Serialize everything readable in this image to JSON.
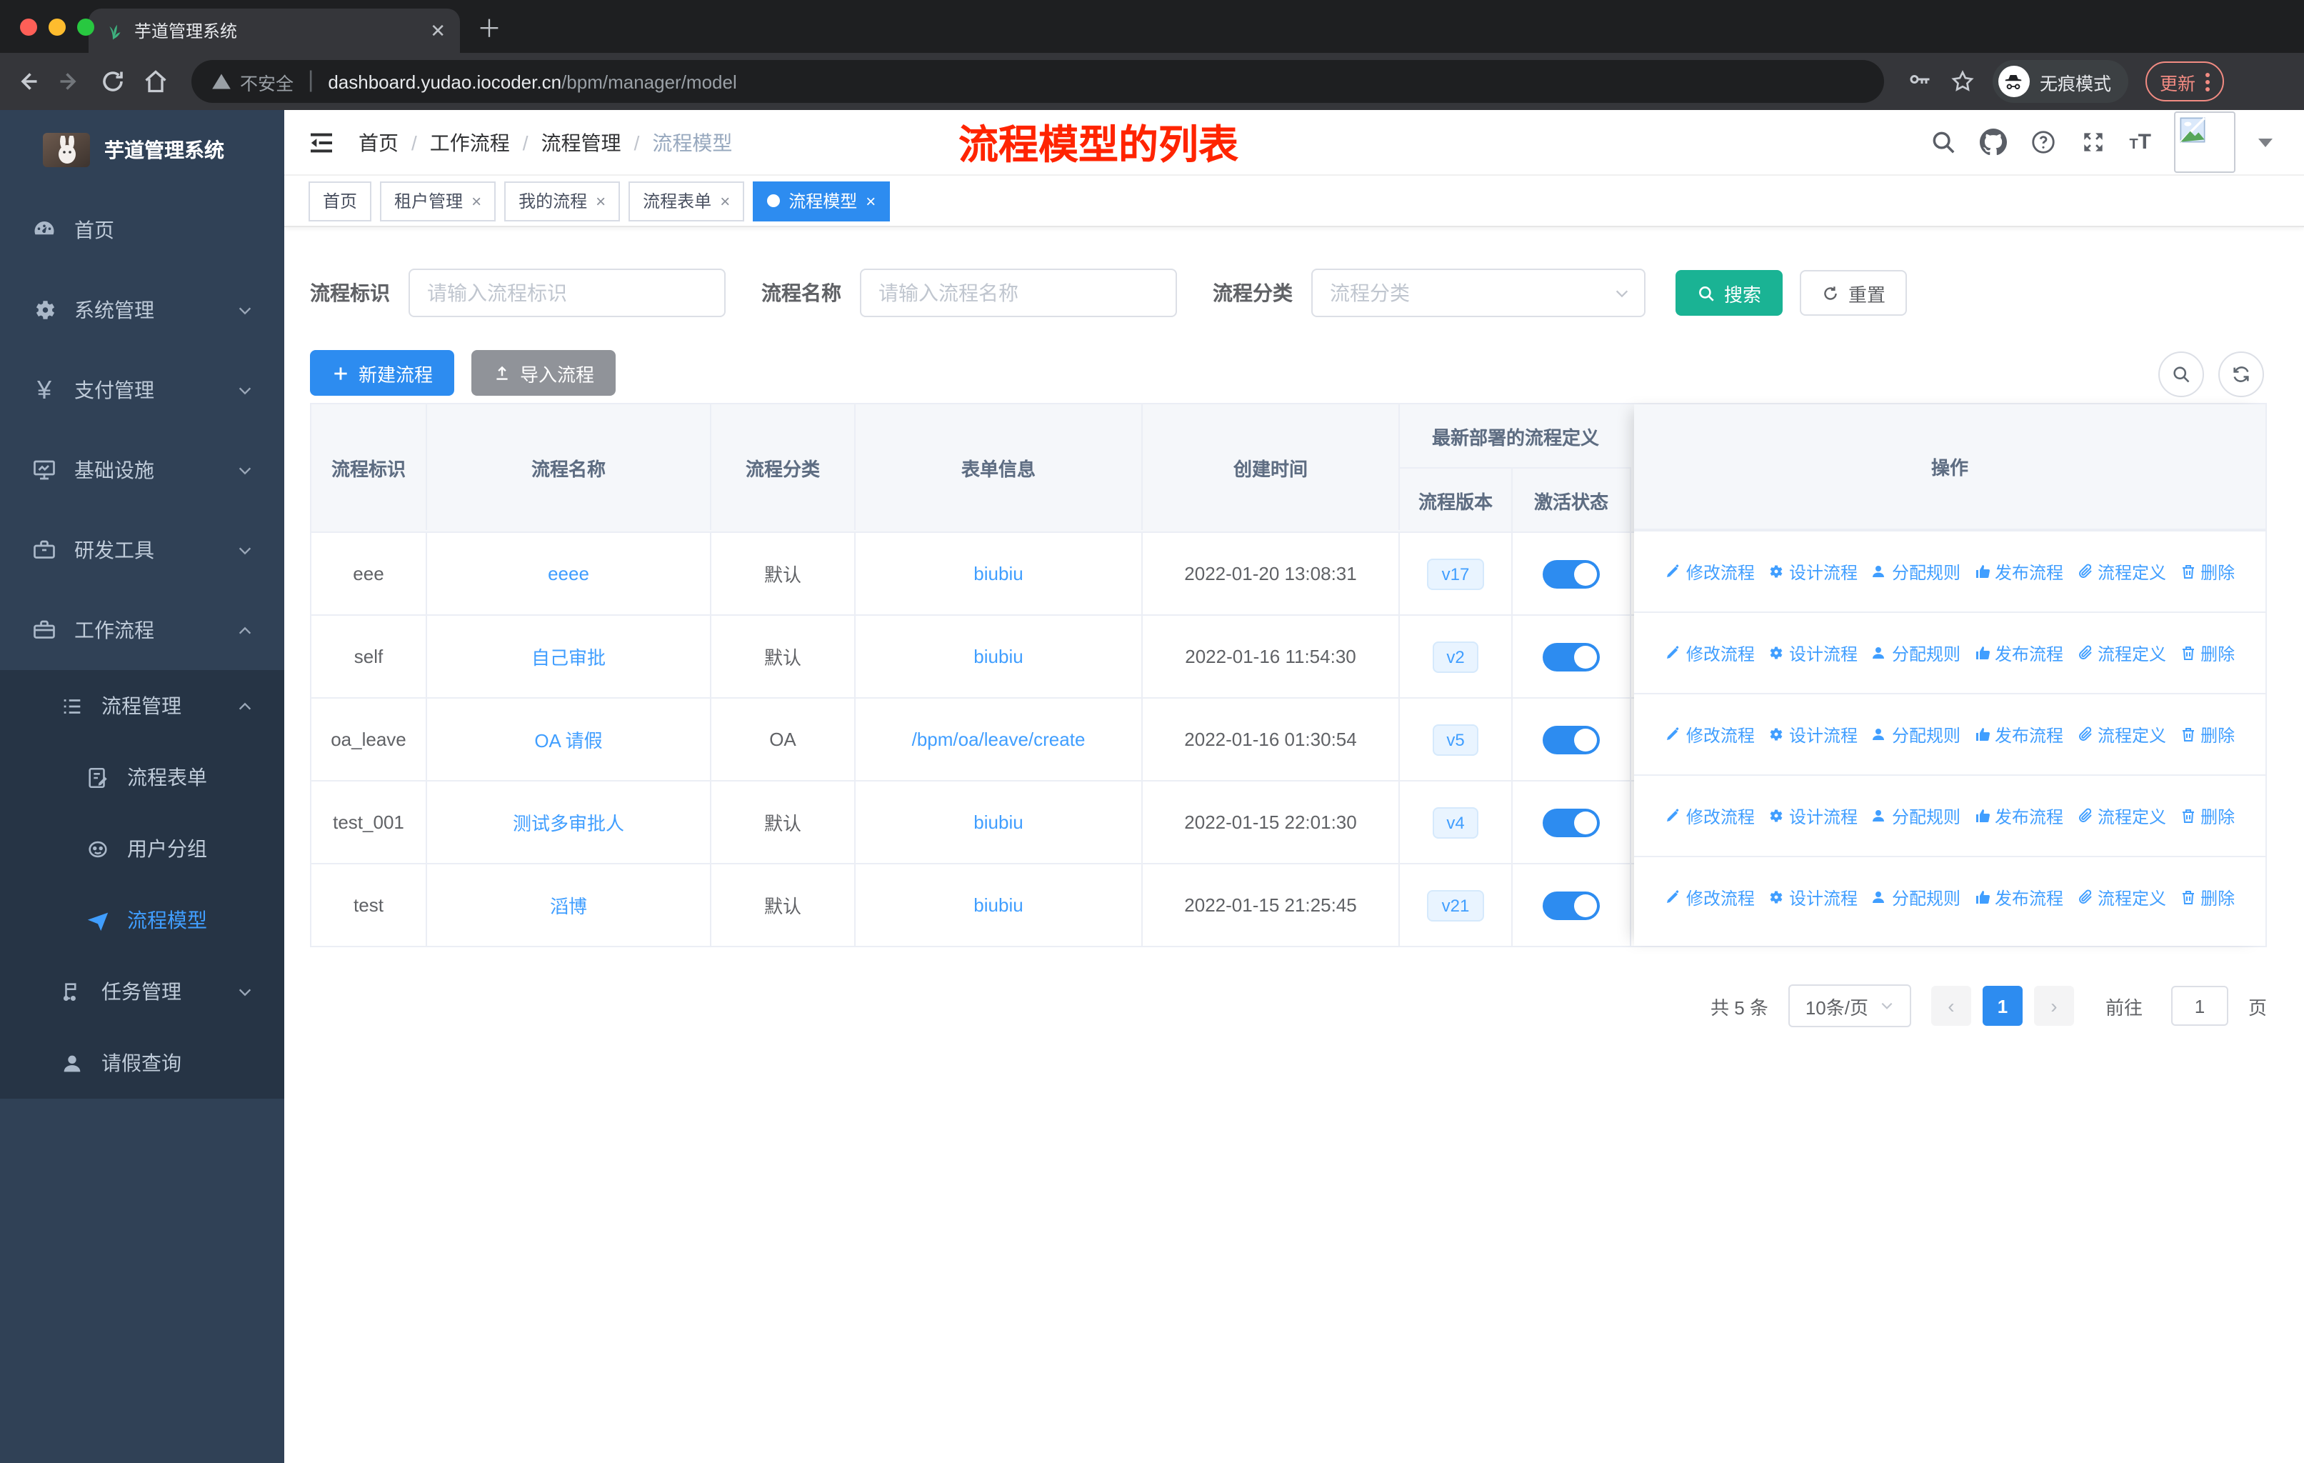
{
  "browser": {
    "tab_title": "芋道管理系统",
    "security_label": "不安全",
    "url_host": "dashboard.yudao.iocoder.cn",
    "url_path": "/bpm/manager/model",
    "incognito_label": "无痕模式",
    "update_label": "更新"
  },
  "sidebar": {
    "app_title": "芋道管理系统",
    "items": [
      {
        "label": "首页",
        "icon": "dashboard-icon",
        "expandable": false
      },
      {
        "label": "系统管理",
        "icon": "gear-icon",
        "expandable": true
      },
      {
        "label": "支付管理",
        "icon": "yen-icon",
        "expandable": true
      },
      {
        "label": "基础设施",
        "icon": "monitor-icon",
        "expandable": true
      },
      {
        "label": "研发工具",
        "icon": "toolbox-icon",
        "expandable": true
      },
      {
        "label": "工作流程",
        "icon": "briefcase-icon",
        "expandable": true,
        "expanded": true
      }
    ],
    "submenu": [
      {
        "label": "流程管理",
        "icon": "list-icon",
        "expanded": true
      },
      {
        "label": "流程表单",
        "icon": "form-icon"
      },
      {
        "label": "用户分组",
        "icon": "robot-icon"
      },
      {
        "label": "流程模型",
        "icon": "paper-plane-icon",
        "active": true
      },
      {
        "label": "任务管理",
        "icon": "tasks-icon",
        "expanded": false
      },
      {
        "label": "请假查询",
        "icon": "user-icon"
      }
    ]
  },
  "header": {
    "breadcrumb": [
      "首页",
      "工作流程",
      "流程管理",
      "流程模型"
    ],
    "annotation": "流程模型的列表"
  },
  "tags": [
    {
      "label": "首页",
      "closable": false,
      "active": false
    },
    {
      "label": "租户管理",
      "closable": true,
      "active": false
    },
    {
      "label": "我的流程",
      "closable": true,
      "active": false
    },
    {
      "label": "流程表单",
      "closable": true,
      "active": false
    },
    {
      "label": "流程模型",
      "closable": true,
      "active": true
    }
  ],
  "filters": {
    "process_key": {
      "label": "流程标识",
      "placeholder": "请输入流程标识",
      "value": ""
    },
    "process_name": {
      "label": "流程名称",
      "placeholder": "请输入流程名称",
      "value": ""
    },
    "category": {
      "label": "流程分类",
      "placeholder": "流程分类",
      "value": ""
    },
    "search_label": "搜索",
    "reset_label": "重置"
  },
  "toolbar": {
    "create_label": "新建流程",
    "import_label": "导入流程"
  },
  "table": {
    "columns": [
      "流程标识",
      "流程名称",
      "流程分类",
      "表单信息",
      "创建时间"
    ],
    "group_header": "最新部署的流程定义",
    "sub_columns": [
      "流程版本",
      "激活状态"
    ],
    "actions_header": "操作",
    "actions": [
      "修改流程",
      "设计流程",
      "分配规则",
      "发布流程",
      "流程定义",
      "删除"
    ],
    "rows": [
      {
        "id": "eee",
        "name": "eeee",
        "category": "默认",
        "form": "biubiu",
        "created": "2022-01-20 13:08:31",
        "version": "v17",
        "active": true
      },
      {
        "id": "self",
        "name": "自己审批",
        "category": "默认",
        "form": "biubiu",
        "created": "2022-01-16 11:54:30",
        "version": "v2",
        "active": true
      },
      {
        "id": "oa_leave",
        "name": "OA 请假",
        "category": "OA",
        "form": "/bpm/oa/leave/create",
        "created": "2022-01-16 01:30:54",
        "version": "v5",
        "active": true
      },
      {
        "id": "test_001",
        "name": "测试多审批人",
        "category": "默认",
        "form": "biubiu",
        "created": "2022-01-15 22:01:30",
        "version": "v4",
        "active": true
      },
      {
        "id": "test",
        "name": "滔博",
        "category": "默认",
        "form": "biubiu",
        "created": "2022-01-15 21:25:45",
        "version": "v21",
        "active": true
      }
    ]
  },
  "pagination": {
    "total": "共 5 条",
    "page_size": "10条/页",
    "current": "1",
    "goto_label": "前往",
    "goto_value": "1",
    "page_unit": "页"
  },
  "colors": {
    "accent_blue": "#409eff",
    "solid_blue": "#2d8cf0",
    "teal_search": "#1ab394",
    "annotation_red": "#ff2400",
    "sidebar_bg": "#304156",
    "submenu_bg": "#263445",
    "chrome_update": "#f28b82"
  }
}
